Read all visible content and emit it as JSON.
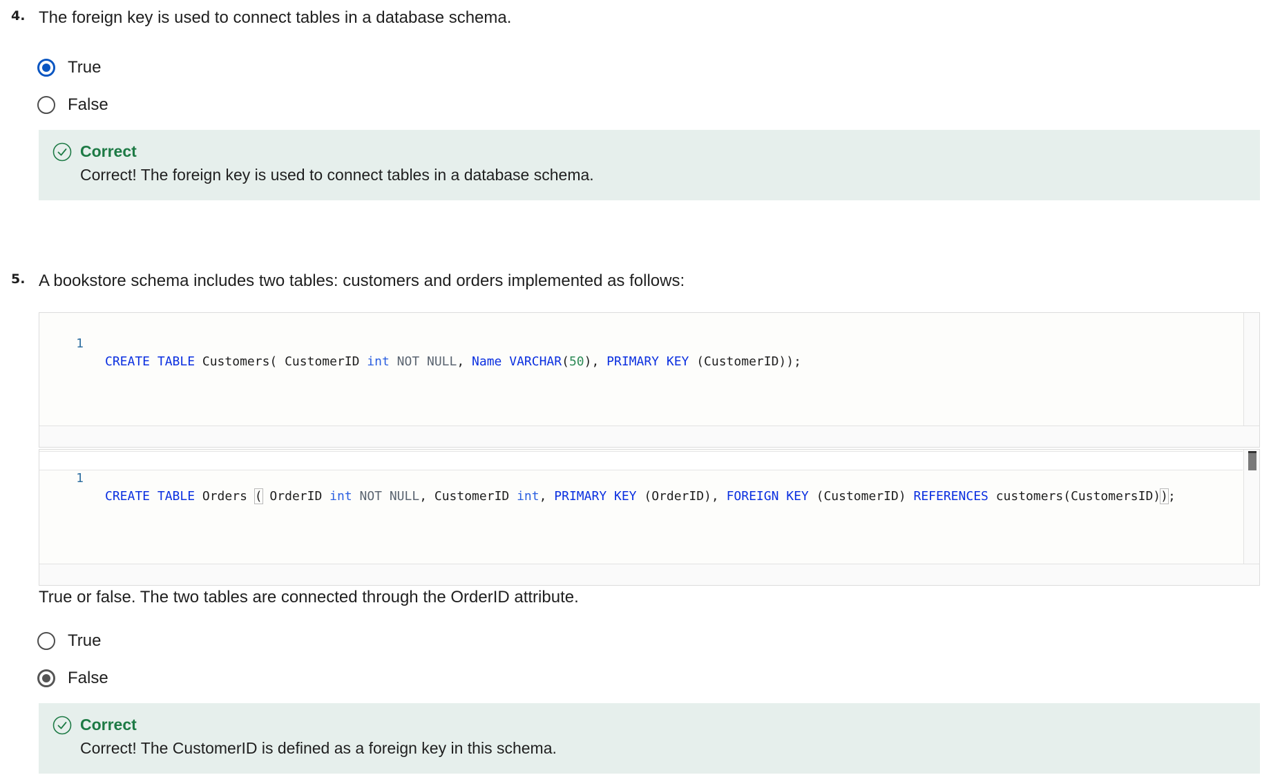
{
  "questions": [
    {
      "number": "4.",
      "prompt": "The foreign key is used to connect tables in a database schema.",
      "options": [
        {
          "label": "True",
          "selected": true
        },
        {
          "label": "False",
          "selected": false
        }
      ],
      "feedback": {
        "title": "Correct",
        "text": "Correct! The foreign key is used to connect tables in a database schema."
      }
    },
    {
      "number": "5.",
      "prompt": "A bookstore schema includes two tables: customers and orders implemented as follows:",
      "code_blocks": [
        {
          "line_number": "1",
          "tokens": [
            {
              "t": "CREATE TABLE",
              "c": "kw"
            },
            {
              "t": " Customers( CustomerID ",
              "c": ""
            },
            {
              "t": "int",
              "c": "type"
            },
            {
              "t": " ",
              "c": ""
            },
            {
              "t": "NOT NULL",
              "c": "nullk"
            },
            {
              "t": ", ",
              "c": ""
            },
            {
              "t": "Name",
              "c": "kw"
            },
            {
              "t": " ",
              "c": ""
            },
            {
              "t": "VARCHAR",
              "c": "kw"
            },
            {
              "t": "(",
              "c": ""
            },
            {
              "t": "50",
              "c": "num"
            },
            {
              "t": "), ",
              "c": ""
            },
            {
              "t": "PRIMARY KEY",
              "c": "kw"
            },
            {
              "t": " (CustomerID));",
              "c": ""
            }
          ]
        },
        {
          "line_number": "1",
          "tokens": [
            {
              "t": "CREATE TABLE",
              "c": "kw"
            },
            {
              "t": " Orders ",
              "c": ""
            },
            {
              "t": "(",
              "c": "bracket"
            },
            {
              "t": " OrderID ",
              "c": ""
            },
            {
              "t": "int",
              "c": "type"
            },
            {
              "t": " ",
              "c": ""
            },
            {
              "t": "NOT NULL",
              "c": "nullk"
            },
            {
              "t": ", CustomerID ",
              "c": ""
            },
            {
              "t": "int",
              "c": "type"
            },
            {
              "t": ", ",
              "c": ""
            },
            {
              "t": "PRIMARY KEY",
              "c": "kw"
            },
            {
              "t": " (OrderID), ",
              "c": ""
            },
            {
              "t": "FOREIGN KEY",
              "c": "kw"
            },
            {
              "t": " (CustomerID) ",
              "c": ""
            },
            {
              "t": "REFERENCES",
              "c": "kw"
            },
            {
              "t": " customers(CustomersID)",
              "c": ""
            },
            {
              "t": ")",
              "c": "bracket"
            },
            {
              "t": ";",
              "c": ""
            }
          ]
        }
      ],
      "sub_prompt": "True or false. The two tables are connected through the OrderID attribute.",
      "options": [
        {
          "label": "True",
          "selected": false
        },
        {
          "label": "False",
          "selected": true
        }
      ],
      "feedback": {
        "title": "Correct",
        "text": "Correct! The CustomerID is defined as a foreign key in this schema."
      }
    }
  ],
  "colors": {
    "selected_radio_q4": "#0a56c2",
    "selected_radio_q5": "#555555",
    "feedback_bg": "#e6efec",
    "feedback_title": "#1d7a45",
    "sql_keyword": "#0a2fe0",
    "sql_null": "#5a6470",
    "sql_number": "#2e8b57"
  }
}
